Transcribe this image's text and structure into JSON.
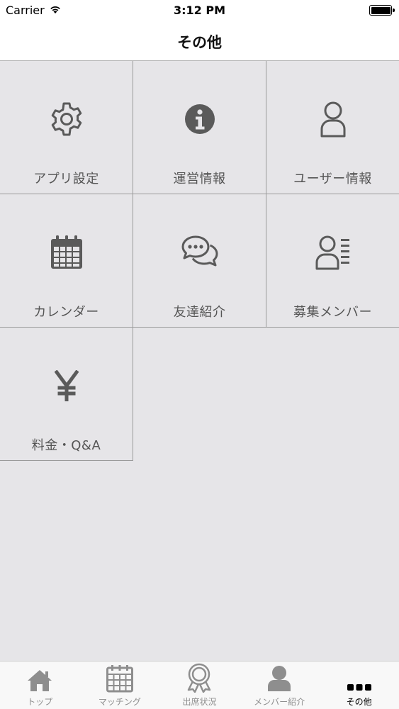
{
  "status": {
    "carrier": "Carrier",
    "time": "3:12 PM"
  },
  "nav": {
    "title": "その他"
  },
  "menu": {
    "items": [
      {
        "label": "アプリ設定",
        "icon": "gear-icon"
      },
      {
        "label": "運営情報",
        "icon": "info-icon"
      },
      {
        "label": "ユーザー情報",
        "icon": "user-icon"
      },
      {
        "label": "カレンダー",
        "icon": "calendar-icon"
      },
      {
        "label": "友達紹介",
        "icon": "chat-bubbles-icon"
      },
      {
        "label": "募集メンバー",
        "icon": "member-list-icon"
      },
      {
        "label": "料金・Q&A",
        "icon": "yen-icon"
      }
    ]
  },
  "tabs": {
    "items": [
      {
        "label": "トップ",
        "icon": "home-icon"
      },
      {
        "label": "マッチング",
        "icon": "calendar-icon"
      },
      {
        "label": "出席状況",
        "icon": "award-icon"
      },
      {
        "label": "メンバー紹介",
        "icon": "person-icon"
      },
      {
        "label": "その他",
        "icon": "more-icon"
      }
    ],
    "active_index": 4
  },
  "colors": {
    "background": "#e6e5e8",
    "icon": "#5a5a5a",
    "grid_line": "#9a9a9a",
    "tab_inactive": "#8e8e8e",
    "tab_active": "#000000"
  }
}
